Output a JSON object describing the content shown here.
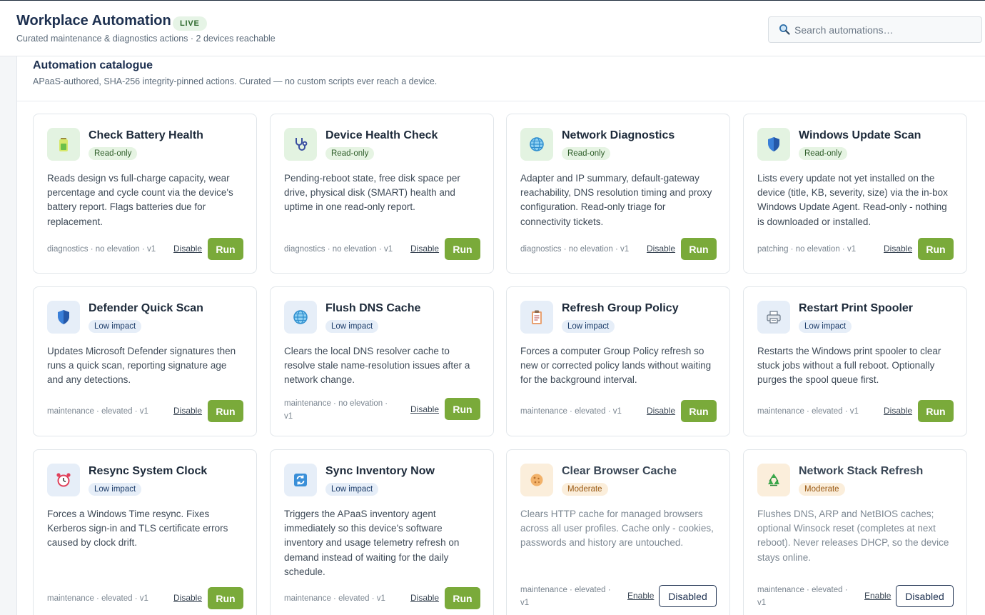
{
  "header": {
    "title": "Workplace Automation",
    "live_badge": "LIVE",
    "subtitle": "Curated maintenance & diagnostics actions · 2 devices reachable"
  },
  "search": {
    "placeholder": "Search automations…",
    "value": ""
  },
  "catalogue": {
    "title": "Automation catalogue",
    "subtitle": "APaaS-authored, SHA-256 integrity-pinned actions. Curated — no custom scripts ever reach a device."
  },
  "colors": {
    "brand": "#1d3050",
    "run_button": "#7aaa3a",
    "readonly_badge": "#e6f4e3",
    "low_impact_badge": "#e6eef8",
    "moderate_badge": "#fbeedb"
  },
  "cards": [
    {
      "title": "Check Battery Health",
      "badge": "Read-only",
      "icon": "battery-icon",
      "description": "Reads design vs full-charge capacity, wear percentage and cycle count via the device's battery report. Flags batteries due for replacement.",
      "meta": "diagnostics · no elevation · v1",
      "toggle": "Disable",
      "action": "Run"
    },
    {
      "title": "Device Health Check",
      "badge": "Read-only",
      "icon": "stethoscope-icon",
      "description": "Pending-reboot state, free disk space per drive, physical disk (SMART) health and uptime in one read-only report.",
      "meta": "diagnostics · no elevation · v1",
      "toggle": "Disable",
      "action": "Run"
    },
    {
      "title": "Network Diagnostics",
      "badge": "Read-only",
      "icon": "globe-icon",
      "description": "Adapter and IP summary, default-gateway reachability, DNS resolution timing and proxy configuration. Read-only triage for connectivity tickets.",
      "meta": "diagnostics · no elevation · v1",
      "toggle": "Disable",
      "action": "Run"
    },
    {
      "title": "Windows Update Scan",
      "badge": "Read-only",
      "icon": "shield-icon",
      "description": "Lists every update not yet installed on the device (title, KB, severity, size) via the in-box Windows Update Agent. Read-only - nothing is downloaded or installed.",
      "meta": "patching · no elevation · v1",
      "toggle": "Disable",
      "action": "Run"
    },
    {
      "title": "Defender Quick Scan",
      "badge": "Low impact",
      "icon": "shield-icon",
      "description": "Updates Microsoft Defender signatures then runs a quick scan, reporting signature age and any detections.",
      "meta": "maintenance · elevated · v1",
      "toggle": "Disable",
      "action": "Run"
    },
    {
      "title": "Flush DNS Cache",
      "badge": "Low impact",
      "icon": "globe-icon",
      "description": "Clears the local DNS resolver cache to resolve stale name-resolution issues after a network change.",
      "meta": "maintenance · no elevation · v1",
      "toggle": "Disable",
      "action": "Run"
    },
    {
      "title": "Refresh Group Policy",
      "badge": "Low impact",
      "icon": "clipboard-icon",
      "description": "Forces a computer Group Policy refresh so new or corrected policy lands without waiting for the background interval.",
      "meta": "maintenance · elevated · v1",
      "toggle": "Disable",
      "action": "Run"
    },
    {
      "title": "Restart Print Spooler",
      "badge": "Low impact",
      "icon": "printer-icon",
      "description": "Restarts the Windows print spooler to clear stuck jobs without a full reboot. Optionally purges the spool queue first.",
      "meta": "maintenance · elevated · v1",
      "toggle": "Disable",
      "action": "Run"
    },
    {
      "title": "Resync System Clock",
      "badge": "Low impact",
      "icon": "alarm-clock-icon",
      "description": "Forces a Windows Time resync. Fixes Kerberos sign-in and TLS certificate errors caused by clock drift.",
      "meta": "maintenance · elevated · v1",
      "toggle": "Disable",
      "action": "Run"
    },
    {
      "title": "Sync Inventory Now",
      "badge": "Low impact",
      "icon": "sync-icon",
      "description": "Triggers the APaaS inventory agent immediately so this device's software inventory and usage telemetry refresh on demand instead of waiting for the daily schedule.",
      "meta": "maintenance · elevated · v1",
      "toggle": "Disable",
      "action": "Run"
    },
    {
      "title": "Clear Browser Cache",
      "badge": "Moderate",
      "icon": "cookie-icon",
      "description": "Clears HTTP cache for managed browsers across all user profiles. Cache only - cookies, passwords and history are untouched.",
      "meta": "maintenance · elevated · v1",
      "toggle": "Enable",
      "action": "Disabled"
    },
    {
      "title": "Network Stack Refresh",
      "badge": "Moderate",
      "icon": "recycle-icon",
      "description": "Flushes DNS, ARP and NetBIOS caches; optional Winsock reset (completes at next reboot). Never releases DHCP, so the device stays online.",
      "meta": "maintenance · elevated · v1",
      "toggle": "Enable",
      "action": "Disabled"
    }
  ]
}
